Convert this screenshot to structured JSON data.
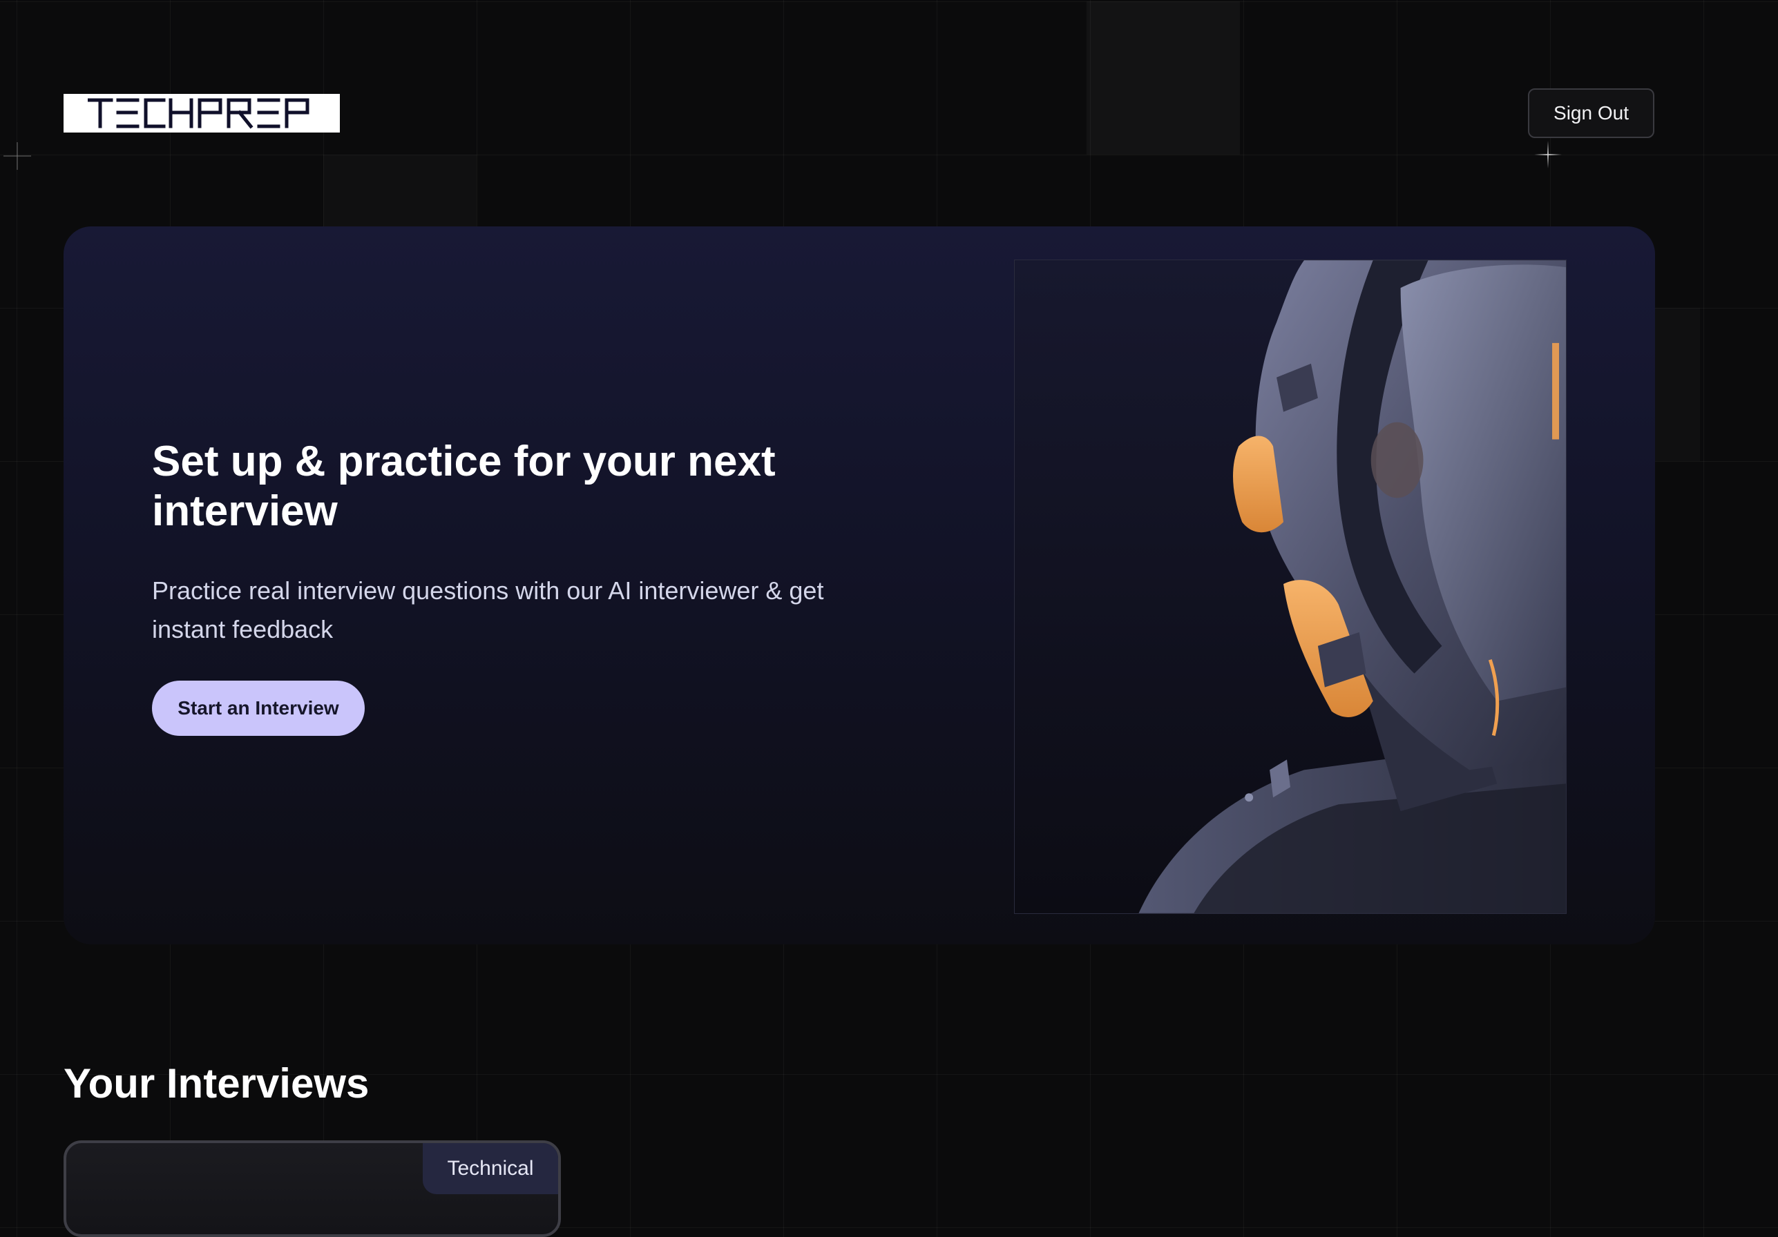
{
  "header": {
    "logo_text": "TECHPREP",
    "sign_out_label": "Sign Out"
  },
  "hero": {
    "title": "Set up & practice for your next interview",
    "subtitle": "Practice real interview questions with our AI interviewer & get instant feedback",
    "cta_label": "Start an Interview",
    "image_icon": "robot-helmet-illustration"
  },
  "interviews": {
    "section_title": "Your Interviews",
    "cards": [
      {
        "badge": "Technical"
      }
    ]
  },
  "colors": {
    "background": "#0b0b0c",
    "hero_card": "#181935",
    "accent_button": "#cac5fb",
    "badge_bg": "#252740",
    "robot_orange": "#f0a050"
  }
}
